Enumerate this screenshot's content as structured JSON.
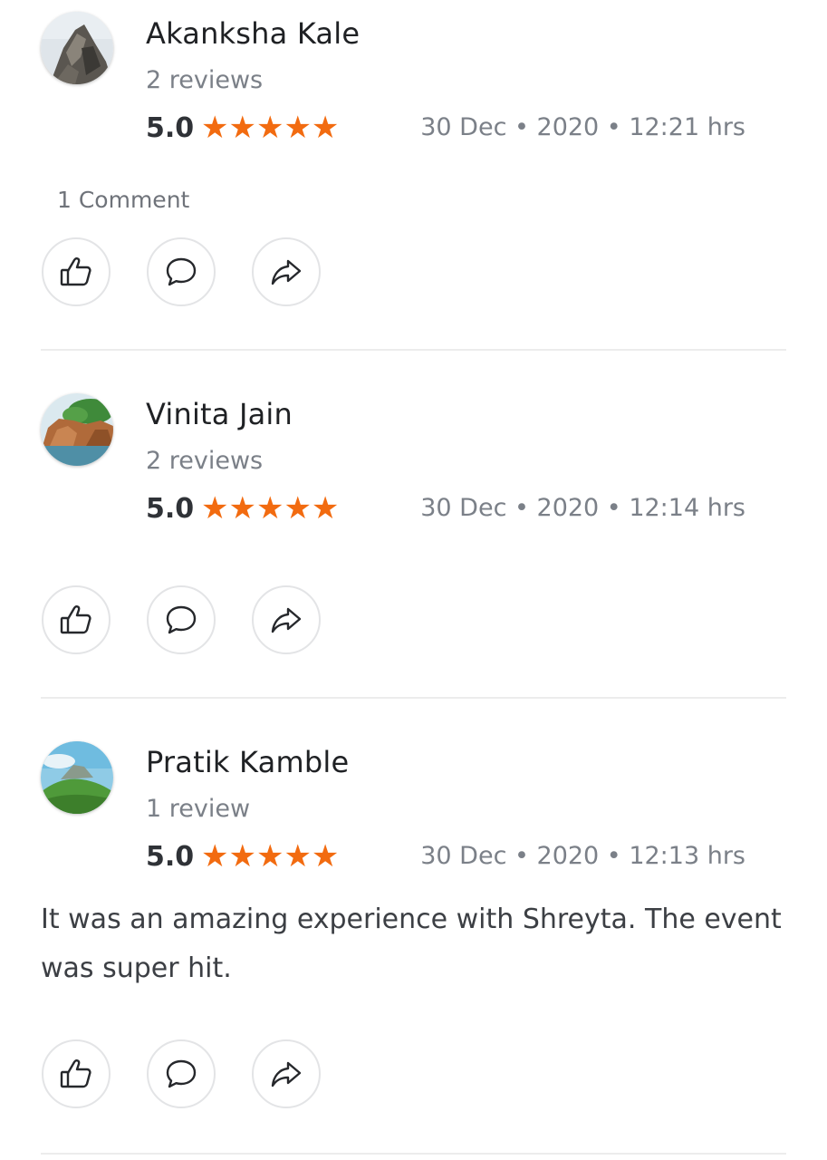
{
  "reviews": [
    {
      "name": "Akanksha Kale",
      "review_count": "2 reviews",
      "rating": "5.0",
      "stars": "★★★★★",
      "date": "30 Dec • 2020 • 12:21 hrs",
      "comment_count": "1 Comment",
      "text": "",
      "avatar": "rocky-peak-avatar"
    },
    {
      "name": "Vinita Jain",
      "review_count": "2 reviews",
      "rating": "5.0",
      "stars": "★★★★★",
      "date": "30 Dec • 2020 • 12:14 hrs",
      "comment_count": "",
      "text": "",
      "avatar": "coastal-cliff-avatar"
    },
    {
      "name": "Pratik Kamble",
      "review_count": "1 review",
      "rating": "5.0",
      "stars": "★★★★★",
      "date": "30 Dec • 2020 • 12:13 hrs",
      "comment_count": "",
      "text": "It was an amazing experience with Shreyta. The event was super hit.",
      "avatar": "green-hill-avatar"
    }
  ],
  "actions": {
    "like_icon": "thumbs-up-icon",
    "comment_icon": "comment-bubble-icon",
    "share_icon": "share-arrow-icon"
  },
  "colors": {
    "star": "#f26b10",
    "muted_text": "#7b8088",
    "divider": "#ececec"
  }
}
